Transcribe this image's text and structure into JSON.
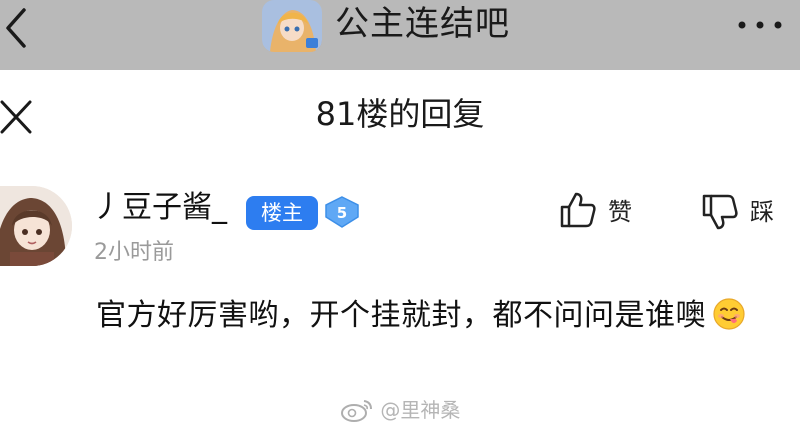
{
  "topbar": {
    "forum_name": "公主连结吧",
    "back_icon": "chevron-left-icon",
    "more_icon": "more-dots-icon"
  },
  "sheet": {
    "title": "81楼的回复",
    "close_icon": "close-icon"
  },
  "post": {
    "username": "丿豆子酱_",
    "host_badge": "楼主",
    "level": "5",
    "time": "2小时前",
    "content": "官方好厉害哟，开个挂就封，都不问问是谁噢",
    "emoji": "smiling-face-tongue-emoji",
    "actions": {
      "like_label": "赞",
      "dislike_label": "踩"
    }
  },
  "watermark": {
    "text": "@里神桑"
  },
  "colors": {
    "topbar_bg": "#b9b9b9",
    "badge_blue": "#2d7df0",
    "muted_text": "#9a9a9a"
  }
}
